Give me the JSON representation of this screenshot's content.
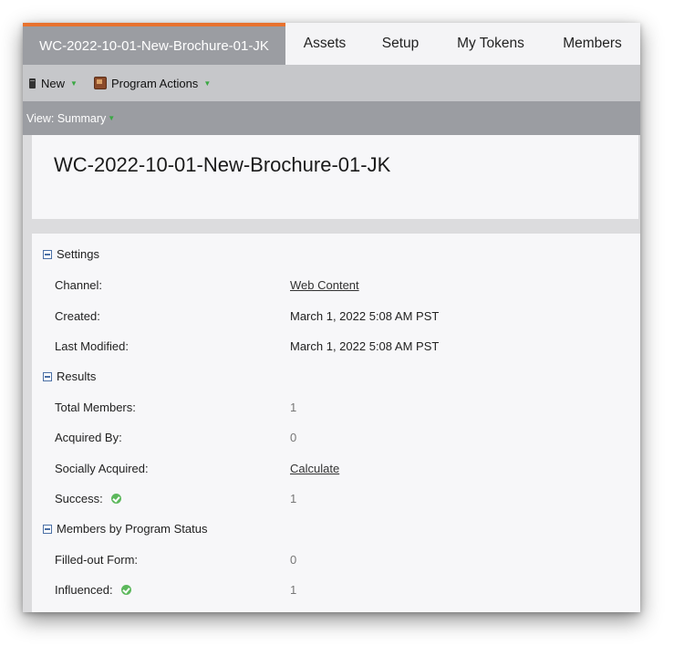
{
  "tabs": [
    {
      "label": "WC-2022-10-01-New-Brochure-01-JK",
      "active": true
    },
    {
      "label": "Assets"
    },
    {
      "label": "Setup"
    },
    {
      "label": "My Tokens"
    },
    {
      "label": "Members"
    }
  ],
  "toolbar": {
    "new_label": "New",
    "program_actions_label": "Program Actions"
  },
  "view": {
    "label": "View: Summary"
  },
  "program": {
    "title": "WC-2022-10-01-New-Brochure-01-JK"
  },
  "sections": {
    "settings": {
      "title": "Settings",
      "channel_label": "Channel:",
      "channel_value": "Web Content",
      "created_label": "Created:",
      "created_value": "March 1, 2022 5:08 AM PST",
      "modified_label": "Last Modified:",
      "modified_value": "March 1, 2022 5:08 AM PST"
    },
    "results": {
      "title": "Results",
      "total_members_label": "Total Members:",
      "total_members_value": "1",
      "acquired_by_label": "Acquired By:",
      "acquired_by_value": "0",
      "socially_acquired_label": "Socially Acquired:",
      "socially_acquired_value": "Calculate",
      "success_label": "Success:",
      "success_value": "1"
    },
    "members_by_status": {
      "title": "Members by Program Status",
      "filled_form_label": "Filled-out Form:",
      "filled_form_value": "0",
      "influenced_label": "Influenced:",
      "influenced_value": "1"
    }
  },
  "colors": {
    "accent_tab_border": "#e8722e",
    "success_green": "#5cb85c"
  }
}
